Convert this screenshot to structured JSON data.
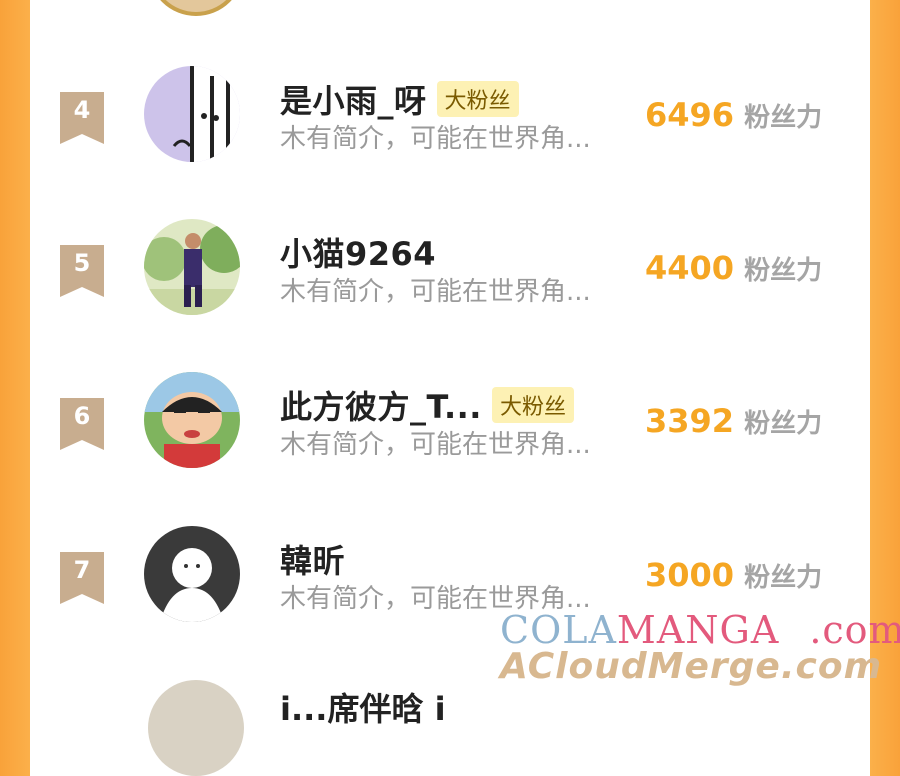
{
  "rows": [
    {
      "rank": "4",
      "name": "是小雨_呀",
      "tag": "大粉丝",
      "bio": "木有简介，可能在世界角...",
      "score": "6496",
      "unit": "粉丝力"
    },
    {
      "rank": "5",
      "name": "小猫9264",
      "tag": "",
      "bio": "木有简介，可能在世界角...",
      "score": "4400",
      "unit": "粉丝力"
    },
    {
      "rank": "6",
      "name": "此方彼方_T...",
      "tag": "大粉丝",
      "bio": "木有简介，可能在世界角...",
      "score": "3392",
      "unit": "粉丝力"
    },
    {
      "rank": "7",
      "name": "韓昕",
      "tag": "",
      "bio": "木有简介，可能在世界角...",
      "score": "3000",
      "unit": "粉丝力"
    }
  ],
  "partial_row_name": "i...席伴晗 i",
  "watermark": {
    "part1": "COLA",
    "part2": "MANGA",
    "part3": ".com",
    "line2": "ACloudMerge.com"
  },
  "colors": {
    "accent": "#f5a623",
    "badge": "#c8ad8f",
    "tag_bg": "#fdf1b4",
    "side": "#f9a23a"
  },
  "icons": [
    "rank-ribbon-icon",
    "avatar-icon"
  ]
}
